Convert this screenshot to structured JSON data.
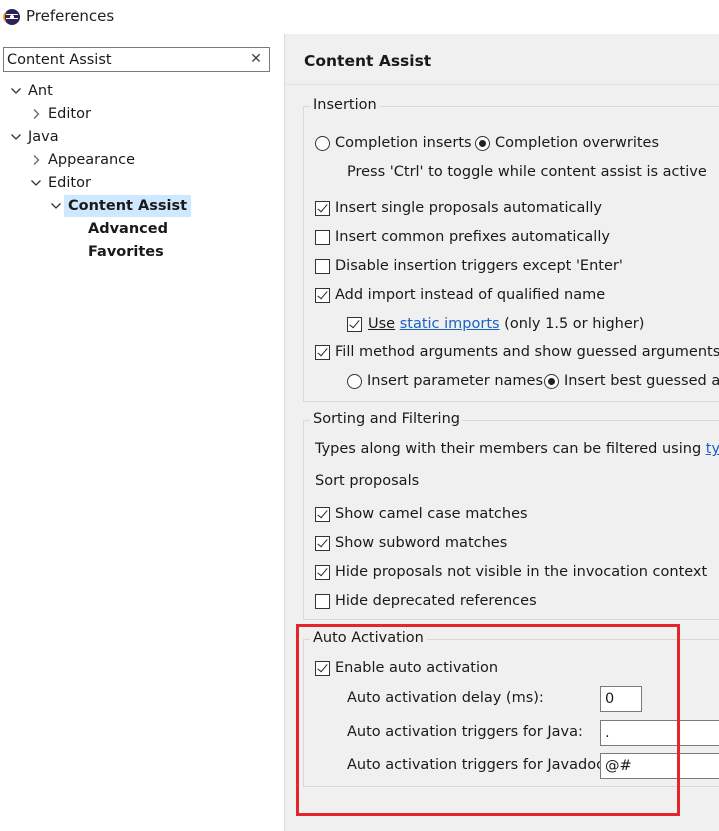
{
  "window": {
    "title": "Preferences",
    "icon": "eclipse-icon"
  },
  "filter": {
    "value": "Content Assist",
    "clear_symbol": "✕"
  },
  "tree": {
    "ant": "Ant",
    "ant_editor": "Editor",
    "java": "Java",
    "appearance": "Appearance",
    "java_editor": "Editor",
    "content_assist": "Content Assist",
    "advanced": "Advanced",
    "favorites": "Favorites"
  },
  "page": {
    "title": "Content Assist"
  },
  "insertion": {
    "label": "Insertion",
    "completion_inserts": "Completion inserts",
    "completion_overwrites": "Completion overwrites",
    "toggle_hint": "Press 'Ctrl' to toggle while content assist is active",
    "insert_single": "Insert single proposals automatically",
    "insert_common": "Insert common prefixes automatically",
    "disable_triggers": "Disable insertion triggers except 'Enter'",
    "add_import": "Add import instead of qualified name",
    "use_prefix": "Use",
    "static_imports_link": "static imports",
    "use_suffix": "(only 1.5 or higher)",
    "fill_method_args": "Fill method arguments and show guessed arguments",
    "insert_param_names": "Insert parameter names",
    "insert_best_guessed": "Insert best guessed arguments"
  },
  "sorting": {
    "label": "Sorting and Filtering",
    "filter_text": "Types along with their members can be filtered using",
    "filter_link": "type filters",
    "sort_proposals": "Sort proposals",
    "camel_case": "Show camel case matches",
    "subword": "Show subword matches",
    "hide_not_visible": "Hide proposals not visible in the invocation context",
    "hide_deprecated": "Hide deprecated references"
  },
  "auto": {
    "label": "Auto Activation",
    "enable": "Enable auto activation",
    "delay_label": "Auto activation delay (ms):",
    "delay_value": "0",
    "java_label": "Auto activation triggers for Java:",
    "java_value": ".",
    "javadoc_label": "Auto activation triggers for Javadoc:",
    "javadoc_value": "@#"
  },
  "colors": {
    "selection": "#cde8ff",
    "link": "#1a62c4",
    "highlight": "#e3262e",
    "page_bg": "#f0f0f0"
  }
}
